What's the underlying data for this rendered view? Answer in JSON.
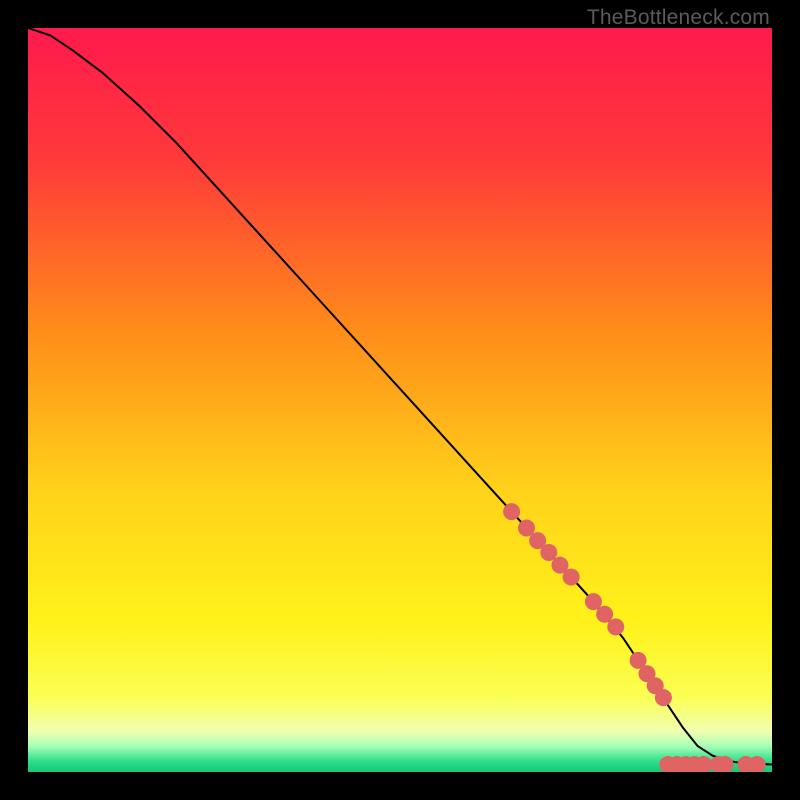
{
  "attribution": "TheBottleneck.com",
  "colors": {
    "frame": "#000000",
    "curve": "#000000",
    "marker_fill": "#e06464",
    "marker_stroke": "#b34a4a",
    "gradient_stops": [
      {
        "offset": 0.0,
        "color": "#ff1a4d"
      },
      {
        "offset": 0.18,
        "color": "#ff3a3a"
      },
      {
        "offset": 0.4,
        "color": "#ff8a1a"
      },
      {
        "offset": 0.62,
        "color": "#ffd21a"
      },
      {
        "offset": 0.8,
        "color": "#fff21a"
      },
      {
        "offset": 0.9,
        "color": "#fbff55"
      },
      {
        "offset": 0.945,
        "color": "#f0ffb0"
      },
      {
        "offset": 0.965,
        "color": "#a8ffb8"
      },
      {
        "offset": 0.985,
        "color": "#2fe08a"
      },
      {
        "offset": 1.0,
        "color": "#14c677"
      }
    ]
  },
  "chart_data": {
    "type": "line",
    "title": "",
    "xlabel": "",
    "ylabel": "",
    "xlim": [
      0,
      100
    ],
    "ylim": [
      0,
      100
    ],
    "series": [
      {
        "name": "curve",
        "x": [
          0,
          3,
          6,
          10,
          15,
          20,
          30,
          40,
          50,
          60,
          65,
          70,
          75,
          80,
          84,
          86,
          88,
          90,
          92,
          94,
          96,
          98,
          100
        ],
        "y": [
          100,
          99,
          97,
          94,
          89.5,
          84.5,
          73.5,
          62.5,
          51.5,
          40.5,
          35,
          29.5,
          24,
          18,
          12,
          9,
          6,
          3.5,
          2.2,
          1.5,
          1.2,
          1.1,
          1.0
        ]
      }
    ],
    "markers_on_curve": {
      "name": "segment-dots",
      "x": [
        65,
        67,
        68.5,
        70,
        71.5,
        73,
        76,
        77.5,
        79,
        82,
        83.2,
        84.3,
        85.4
      ],
      "y": [
        35,
        32.8,
        31.1,
        29.5,
        27.8,
        26.2,
        22.9,
        21.2,
        19.5,
        15,
        13.2,
        11.6,
        10.0
      ]
    },
    "markers_flat": {
      "name": "bottom-dots",
      "x": [
        86,
        87.2,
        88.4,
        89.6,
        90.8,
        92.8,
        93.7,
        96.5,
        98.0
      ],
      "y": [
        1.0,
        1.0,
        1.0,
        1.0,
        1.0,
        1.0,
        1.0,
        1.0,
        1.0
      ]
    }
  }
}
